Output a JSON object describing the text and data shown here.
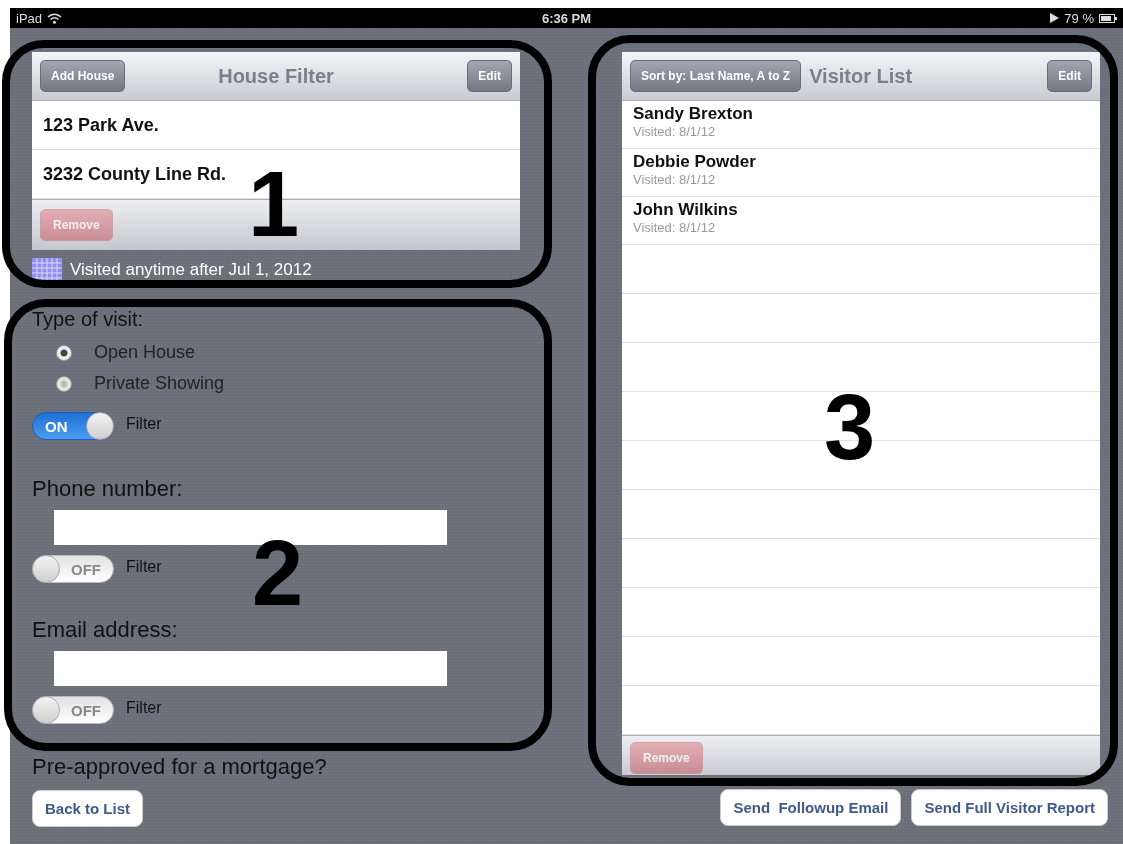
{
  "status_bar": {
    "device": "iPad",
    "time": "6:36 PM",
    "battery": "79 %"
  },
  "house_filter": {
    "title": "House Filter",
    "add_button": "Add House",
    "edit_button": "Edit",
    "houses": [
      {
        "address": "123 Park Ave."
      },
      {
        "address": "3232 County Line Rd."
      }
    ],
    "remove_button": {
      "label": "Remove",
      "disabled": true
    },
    "date_filter": "Visited anytime after Jul 1, 2012"
  },
  "visit_type": {
    "label": "Type of visit:",
    "options": [
      {
        "label": "Open House",
        "selected": true
      },
      {
        "label": "Private Showing",
        "selected": false
      }
    ],
    "filter": {
      "on": true,
      "switch_text": "ON",
      "label": "Filter"
    }
  },
  "fields": [
    {
      "label": "Phone number:",
      "filter": {
        "on": false,
        "switch_text": "OFF",
        "label": "Filter"
      }
    },
    {
      "label": "Email address:",
      "filter": {
        "on": false,
        "switch_text": "OFF",
        "label": "Filter"
      }
    }
  ],
  "mortgage_label": "Pre-approved for a mortgage?",
  "back_button": "Back to List",
  "visitor_list": {
    "title": "Visitor List",
    "sort_button": "Sort by: Last Name, A to Z",
    "edit_button": "Edit",
    "visitors": [
      {
        "name": "Sandy Brexton",
        "visited": "Visited: 8/1/12"
      },
      {
        "name": "Debbie Powder",
        "visited": "Visited: 8/1/12"
      },
      {
        "name": "John Wilkins",
        "visited": "Visited: 8/1/12"
      }
    ],
    "remove_button": {
      "label": "Remove",
      "disabled": true
    }
  },
  "actions": [
    "Send  Followup Email",
    "Send Full Visitor Report"
  ],
  "annotations": [
    {
      "number": "1"
    },
    {
      "number": "2"
    },
    {
      "number": "3"
    }
  ]
}
